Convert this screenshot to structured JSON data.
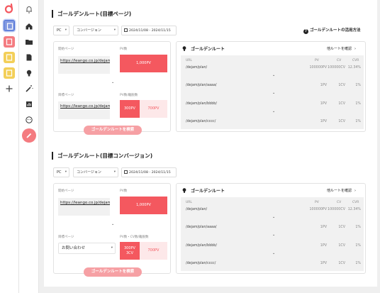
{
  "colors": {
    "accent": "#f4585f",
    "accent_light": "#f6a0a4",
    "pale": "#fde8e9"
  },
  "rail_icons": [
    "doc-blue-icon",
    "doc-red-icon",
    "doc-yellow-icon",
    "doc-yellow-icon",
    "plus-icon"
  ],
  "nav_icons": [
    "bell-icon",
    "home-icon",
    "folder-icon",
    "document-icon",
    "bulb-icon",
    "magic-wand-icon",
    "bar-chart-icon",
    "smile-icon",
    "pencil-icon"
  ],
  "sections": [
    {
      "title": "ゴールデンルート(目標ページ)",
      "device": "PC",
      "metric": "コンバージョン",
      "date": "2024/11/08 - 2024/11/15",
      "howto": "ゴールデンルートの活用方法",
      "start_label": "開始ページ",
      "pv_label": "PV数",
      "start_url": "https://leango.co.jp/dejam/",
      "start_pv": "1,000PV",
      "target_label": "目標ページ",
      "target_pv_label": "PV数/離脱数",
      "target_value": "https://leango.co.jp/dejam/contact",
      "target_is_select": false,
      "seg1": [
        "300PV"
      ],
      "seg2": "700PV",
      "button": "ゴールデンルートを検索",
      "panel_title": "ゴールデンルート",
      "confirm": "他ルートを確認",
      "cols": [
        "URL",
        "PV",
        "CV",
        "CVR"
      ],
      "rows": [
        {
          "url": "/dejam/plan/",
          "pv": "100000PV",
          "cv": "100000CV",
          "cvr": "12.34%"
        },
        {
          "url": "/dejam/plan/aaaa/",
          "pv": "1PV",
          "cv": "1CV",
          "cvr": "1%"
        },
        {
          "url": "/dejam/plan/bbbb/",
          "pv": "1PV",
          "cv": "1CV",
          "cvr": "1%"
        },
        {
          "url": "/dejam/plan/cccc/",
          "pv": "1PV",
          "cv": "1CV",
          "cvr": "1%"
        }
      ]
    },
    {
      "title": "ゴールデンルート(目標コンバージョン)",
      "device": "PC",
      "metric": "コンバージョン",
      "date": "2024/11/08 - 2024/11/15",
      "howto": "",
      "start_label": "開始ページ",
      "pv_label": "PV数",
      "start_url": "https://leango.co.jp/dejam/",
      "start_pv": "1,000PV",
      "target_label": "目標ページ",
      "target_pv_label": "PV数・CV数/離脱数",
      "target_value": "お問い合わせ",
      "target_is_select": true,
      "seg1": [
        "300PV",
        "3CV"
      ],
      "seg2": "700PV",
      "button": "ゴールデンルートを検索",
      "panel_title": "ゴールデンルート",
      "confirm": "他ルートを確認",
      "cols": [
        "URL",
        "PV",
        "CV",
        "CVR"
      ],
      "rows": [
        {
          "url": "/dejam/plan/",
          "pv": "100000PV",
          "cv": "100000CV",
          "cvr": "12.34%"
        },
        {
          "url": "/dejam/plan/aaaa/",
          "pv": "1PV",
          "cv": "1CV",
          "cvr": "1%"
        },
        {
          "url": "/dejam/plan/bbbb/",
          "pv": "1PV",
          "cv": "1CV",
          "cvr": "1%"
        },
        {
          "url": "/dejam/plan/cccc/",
          "pv": "1PV",
          "cv": "1CV",
          "cvr": "1%"
        }
      ]
    }
  ]
}
